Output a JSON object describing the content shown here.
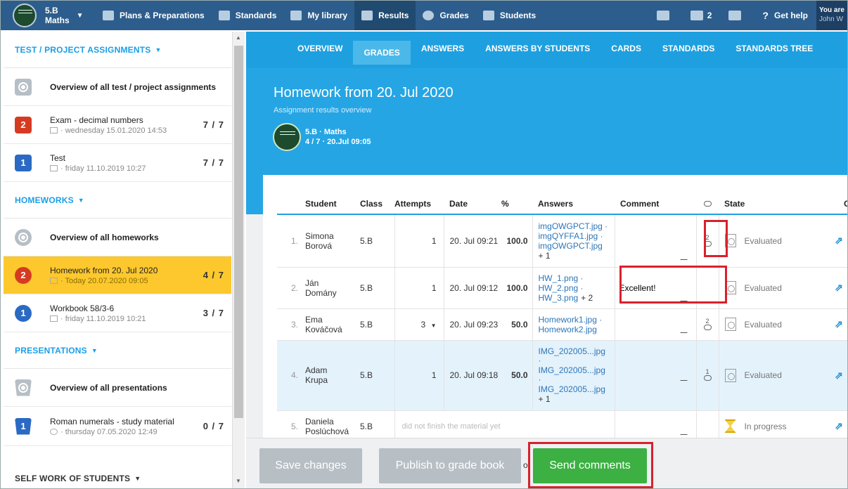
{
  "topbar": {
    "class_name": "5.B",
    "class_subject": "Maths",
    "nav": [
      "Plans & Preparations",
      "Standards",
      "My library",
      "Results",
      "Grades",
      "Students"
    ],
    "messages_count": "2",
    "help": "Get help",
    "you_are": "You are",
    "user_name": "John W"
  },
  "sidebar": {
    "sections": {
      "test": "TEST / PROJECT ASSIGNMENTS",
      "homeworks": "HOMEWORKS",
      "presentations": "PRESENTATIONS",
      "selfwork": "SELF WORK OF STUDENTS"
    },
    "test_items": [
      {
        "title": "Overview of all test / project assignments"
      },
      {
        "badge": "2",
        "title": "Exam - decimal numbers",
        "sub": "· wednesday 15.01.2020 14:53",
        "count": "7 / 7"
      },
      {
        "badge": "1",
        "title": "Test",
        "sub": "· friday 11.10.2019 10:27",
        "count": "7 / 7"
      }
    ],
    "homework_items": [
      {
        "title": "Overview of all homeworks"
      },
      {
        "badge": "2",
        "title": "Homework from 20. Jul 2020",
        "sub": "· Today 20.07.2020 09:05",
        "count": "4 / 7"
      },
      {
        "badge": "1",
        "title": "Workbook 58/3-6",
        "sub": "· friday 11.10.2019 10:21",
        "count": "3 / 7"
      }
    ],
    "presentation_items": [
      {
        "title": "Overview of all presentations"
      },
      {
        "badge": "1",
        "title": "Roman numerals - study material",
        "sub": "· thursday 07.05.2020 12:49",
        "count": "0 / 7"
      }
    ]
  },
  "tabs": [
    "OVERVIEW",
    "GRADES",
    "ANSWERS",
    "ANSWERS BY STUDENTS",
    "CARDS",
    "STANDARDS",
    "STANDARDS TREE"
  ],
  "header": {
    "title": "Homework from 20. Jul 2020",
    "subtitle": "Assignment results overview",
    "class_line": "5.B · Maths",
    "stats_line": "4 / 7 · 20.Jul 09:05"
  },
  "table": {
    "columns": [
      "Student",
      "Class",
      "Attempts",
      "Date",
      "%",
      "Answers",
      "Comment",
      "State",
      "Gr"
    ],
    "rows": [
      {
        "num": "1.",
        "first": "Simona",
        "last": "Borová",
        "class": "5.B",
        "attempts": "1",
        "date": "20. Jul 09:21",
        "pct": "100.0",
        "answers": [
          "imgOWGPCT.jpg ·",
          "imgQYFFA1.jpg ·",
          "imgOWGPCT.jpg"
        ],
        "more": "+ 1",
        "comment": "",
        "ccount": "2",
        "state": "Evaluated"
      },
      {
        "num": "2.",
        "first": "Ján",
        "last": "Domány",
        "class": "5.B",
        "attempts": "1",
        "date": "20. Jul 09:12",
        "pct": "100.0",
        "answers": [
          "HW_1.png ·",
          "HW_2.png ·",
          "HW_3.png"
        ],
        "more": "+ 2",
        "comment": "Excellent!",
        "ccount": "",
        "state": "Evaluated"
      },
      {
        "num": "3.",
        "first": "Ema",
        "last": "Kováčová",
        "class": "5.B",
        "attempts": "3",
        "date": "20. Jul 09:23",
        "pct": "50.0",
        "answers": [
          "Homework1.jpg ·",
          "Homework2.jpg"
        ],
        "more": "",
        "comment": "",
        "ccount": "2",
        "state": "Evaluated"
      },
      {
        "num": "4.",
        "first": "Adam",
        "last": "Krupa",
        "class": "5.B",
        "attempts": "1",
        "date": "20. Jul 09:18",
        "pct": "50.0",
        "answers": [
          "IMG_202005...jpg",
          "·",
          "IMG_202005...jpg",
          "·",
          "IMG_202005...jpg"
        ],
        "more": "+ 1",
        "comment": "",
        "ccount": "1",
        "state": "Evaluated"
      },
      {
        "num": "5.",
        "first": "Daniela",
        "last": "Poslúchová",
        "class": "5.B",
        "note": "did not finish the material yet",
        "comment": "",
        "ccount": "",
        "state": "In progress"
      }
    ]
  },
  "buttons": {
    "save": "Save changes",
    "publish": "Publish to grade book",
    "or": "o",
    "send": "Send comments"
  }
}
